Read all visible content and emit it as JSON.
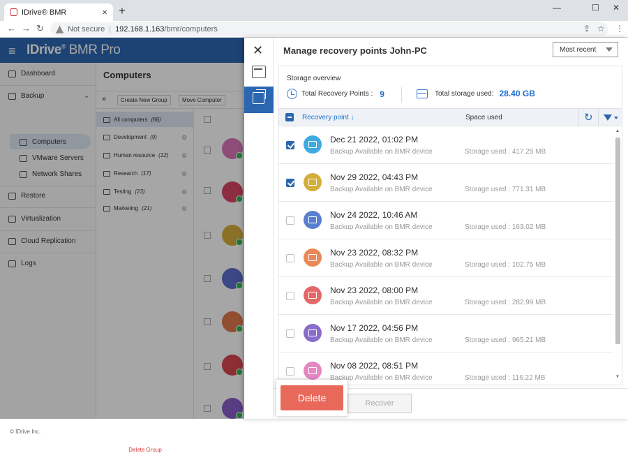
{
  "browser": {
    "tab_title": "IDrive® BMR",
    "new_tab": "+",
    "tab_close": "×",
    "win_min": "—",
    "win_max": "☐",
    "win_close": "✕",
    "not_secure": "Not secure",
    "url_host": "192.168.1.163",
    "url_path": "/bmr/computers"
  },
  "app": {
    "brand_bold": "IDrive",
    "brand_reg": "®",
    "brand_light": " BMR Pro",
    "sidebar": [
      {
        "label": "Dashboard"
      },
      {
        "label": "Backup"
      },
      {
        "label": "Computers"
      },
      {
        "label": "VMware Servers"
      },
      {
        "label": "Network Shares"
      },
      {
        "label": "Restore"
      },
      {
        "label": "Virtualization"
      },
      {
        "label": "Cloud Replication"
      },
      {
        "label": "Logs"
      }
    ],
    "copyright": "© IDrive Inc.",
    "computers_title": "Computers",
    "tool_new_group": "Create New Group",
    "tool_move": "Move Computer",
    "groups": [
      {
        "label": "All computers",
        "count": "(86)"
      },
      {
        "label": "Development",
        "count": "(9)"
      },
      {
        "label": "Human resource",
        "count": "(12)"
      },
      {
        "label": "Research",
        "count": "(17)"
      },
      {
        "label": "Testing",
        "count": "(23)"
      },
      {
        "label": "Marketing",
        "count": "(21)"
      }
    ],
    "delete_group": "Delete Group"
  },
  "panel": {
    "title": "Manage recovery points John-PC",
    "sort_selected": "Most recent",
    "storage_overview": "Storage overview",
    "total_points_label": "Total Recovery Points :",
    "total_points_value": "9",
    "total_storage_label": "Total storage used:",
    "total_storage_value": "28.40 GB",
    "col_recovery_point": "Recovery point ↓",
    "col_space_used": "Space used",
    "refresh_icon": "↻",
    "recover_label": "Recover",
    "delete_label": "Delete",
    "close_icon": "✕",
    "rows": [
      {
        "date": "Dec 21 2022, 01:02 PM",
        "status": "Backup Available on BMR device",
        "size": "Storage used : 417.25 MB",
        "checked": true,
        "color": "#3fa9e0"
      },
      {
        "date": "Nov 29 2022, 04:43 PM",
        "status": "Backup Available on BMR device",
        "size": "Storage used : 771.31 MB",
        "checked": true,
        "color": "#d4ae3b"
      },
      {
        "date": "Nov 24 2022, 10:46 AM",
        "status": "Backup Available on BMR device",
        "size": "Storage used : 163.02 MB",
        "checked": false,
        "color": "#5b7fcf"
      },
      {
        "date": "Nov 23 2022, 08:32 PM",
        "status": "Backup Available on BMR device",
        "size": "Storage used : 102.75 MB",
        "checked": false,
        "color": "#ea8857"
      },
      {
        "date": "Nov 23 2022, 08:00 PM",
        "status": "Backup Available on BMR device",
        "size": "Storage used : 282.99 MB",
        "checked": false,
        "color": "#e56868"
      },
      {
        "date": "Nov 17 2022, 04:56 PM",
        "status": "Backup Available on BMR device",
        "size": "Storage used : 965.21 MB",
        "checked": false,
        "color": "#8a6cc9"
      },
      {
        "date": "Nov 08 2022, 08:51 PM",
        "status": "Backup Available on BMR device",
        "size": "Storage used : 116.22 MB",
        "checked": false,
        "color": "#e587c3"
      }
    ]
  },
  "background_avatars": [
    "#d977b8",
    "#d94565",
    "#d4ae3b",
    "#5b6fc9",
    "#e0794c",
    "#d94550",
    "#8a5cc9"
  ]
}
